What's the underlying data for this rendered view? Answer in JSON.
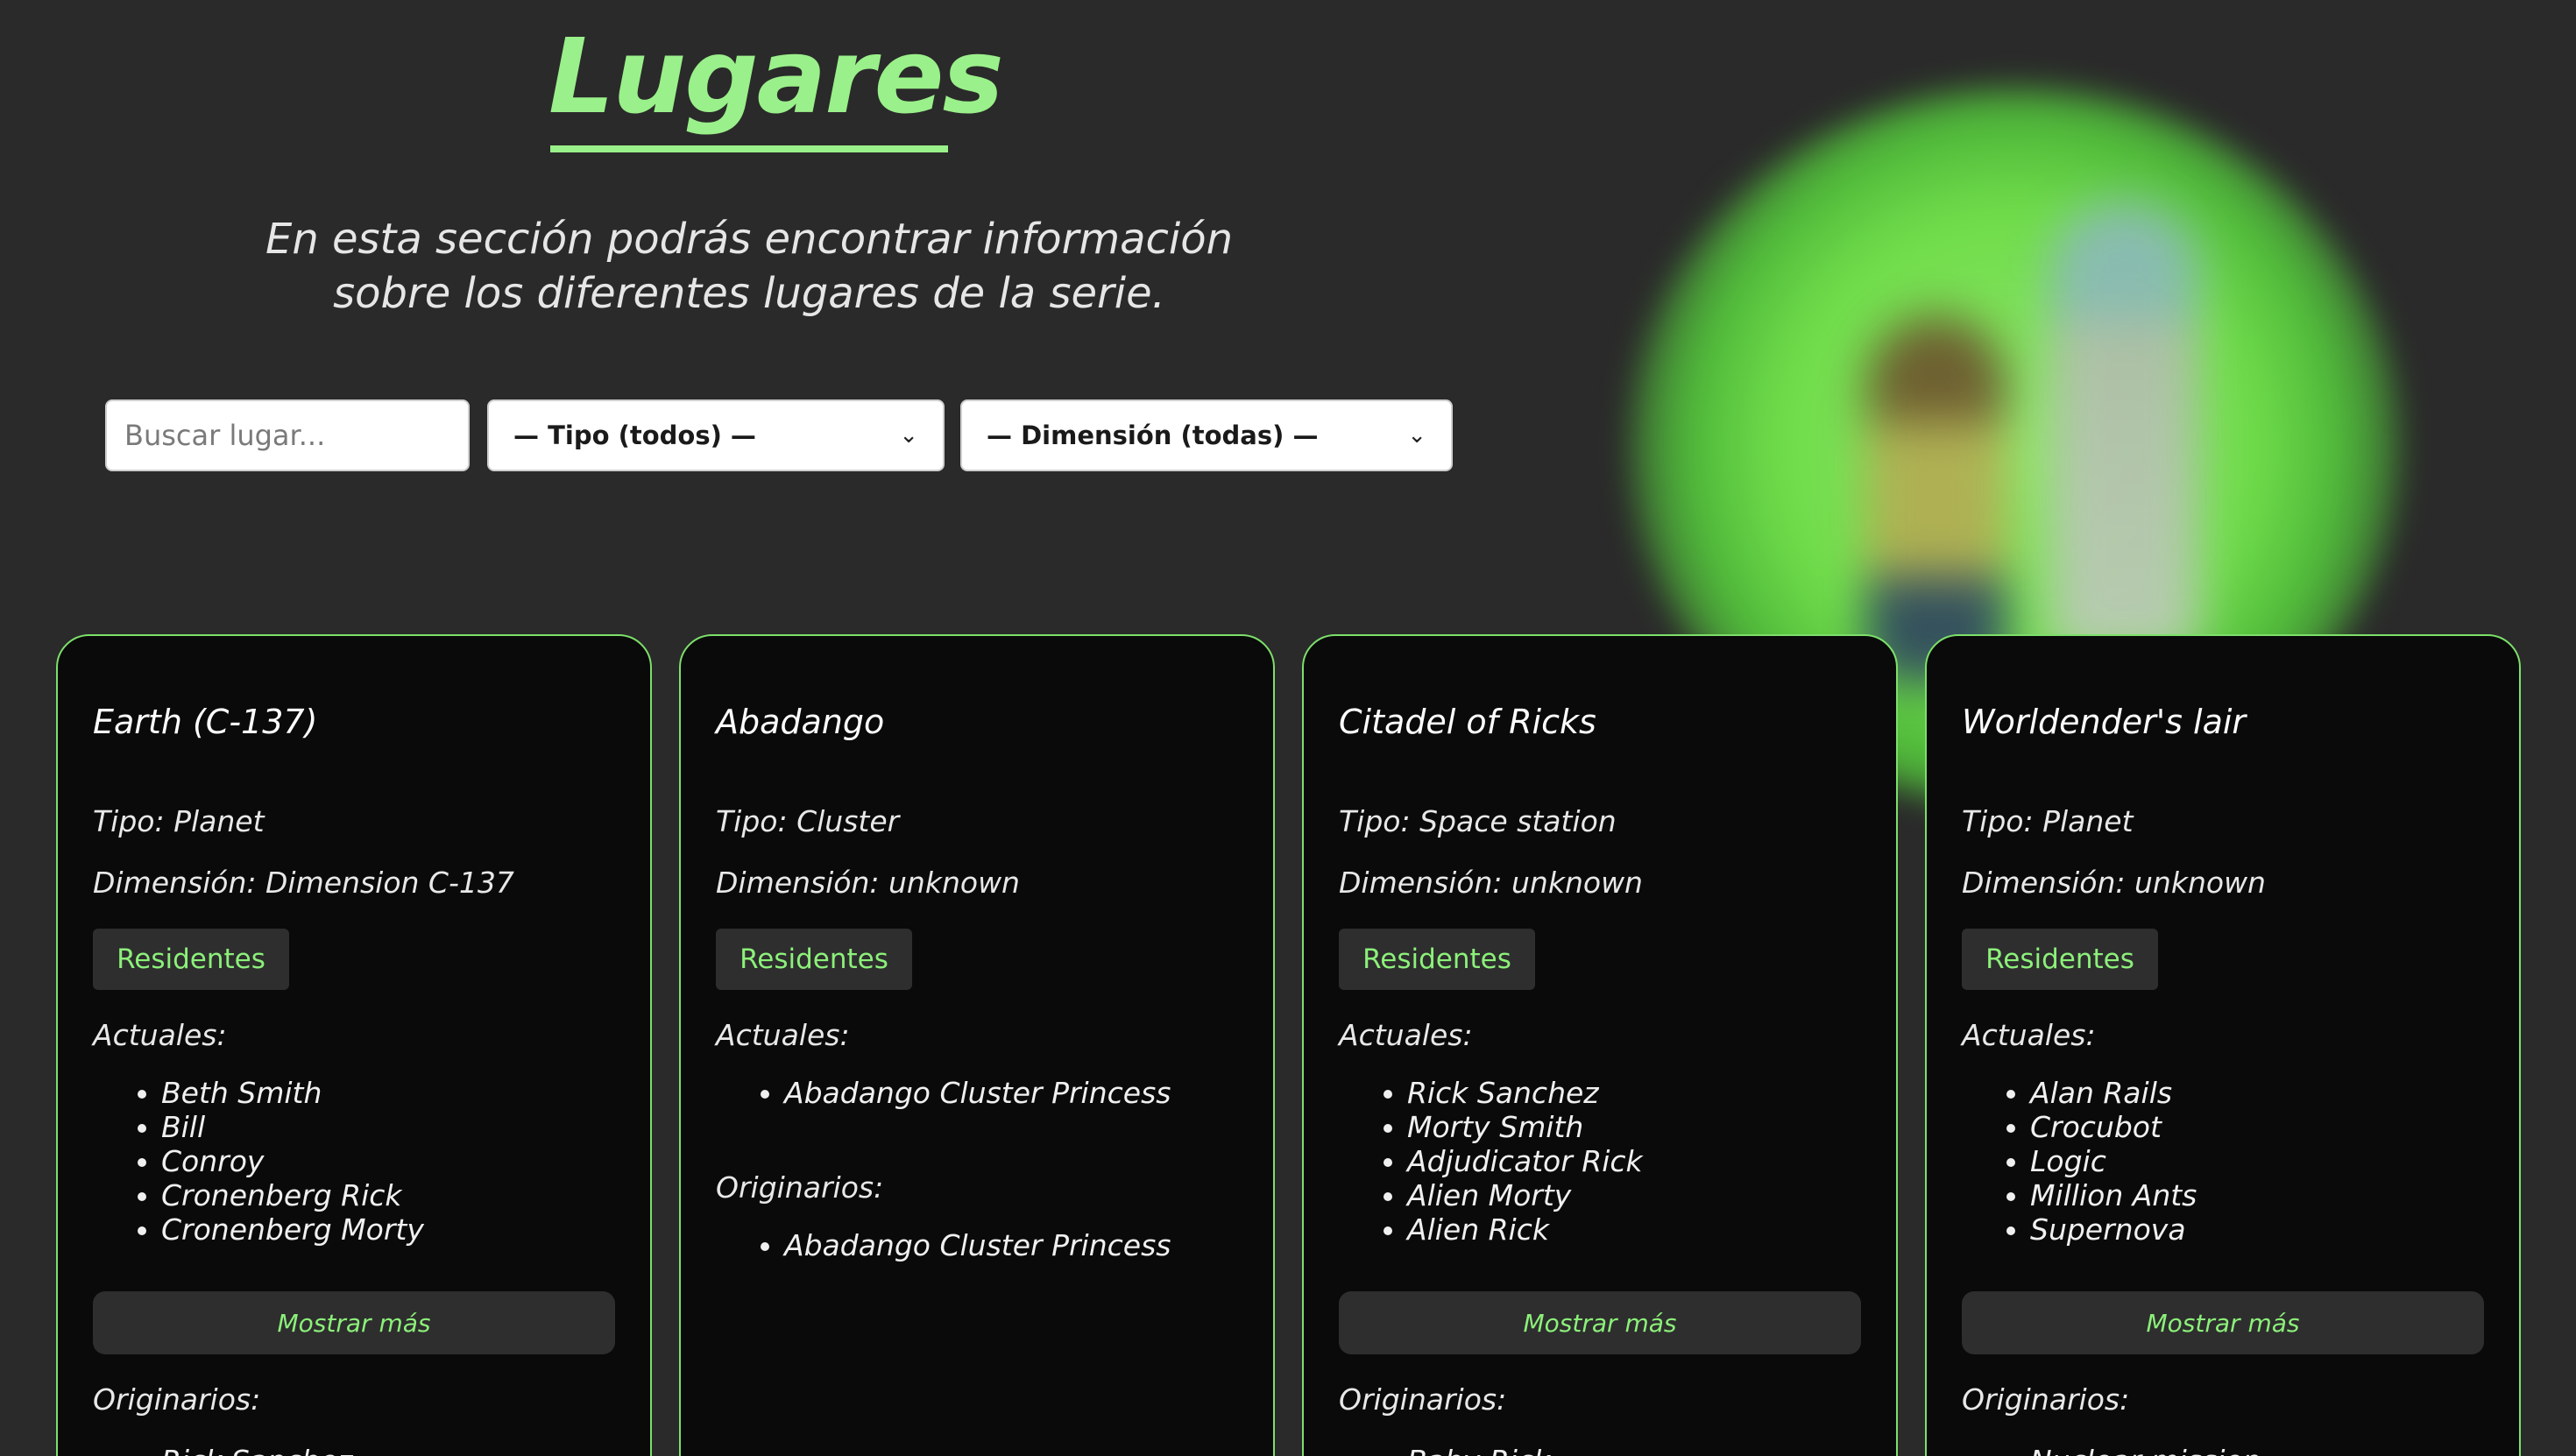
{
  "header": {
    "title": "Lugares",
    "subtitle": "En esta sección podrás encontrar información sobre los diferentes lugares de la serie."
  },
  "filters": {
    "search_placeholder": "Buscar lugar...",
    "type_selected": "— Tipo (todos) —",
    "dimension_selected": "— Dimensión (todas) —"
  },
  "colors": {
    "accent": "#9af08a",
    "background": "#2a2a2a",
    "card_background": "#0a0a0a",
    "card_border": "#7de06a"
  },
  "labels": {
    "residents_button": "Residentes",
    "current": "Actuales:",
    "originals": "Originarios:",
    "show_more": "Mostrar más"
  },
  "cards": [
    {
      "name": "Earth (C-137)",
      "type": "Tipo: Planet",
      "dimension": "Dimensión: Dimension C-137",
      "current": [
        "Beth Smith",
        "Bill",
        "Conroy",
        "Cronenberg Rick",
        "Cronenberg Morty"
      ],
      "originals": [
        "Rick Sanchez"
      ]
    },
    {
      "name": "Abadango",
      "type": "Tipo: Cluster",
      "dimension": "Dimensión: unknown",
      "current": [
        "Abadango Cluster Princess"
      ],
      "originals": [
        "Abadango Cluster Princess"
      ]
    },
    {
      "name": "Citadel of Ricks",
      "type": "Tipo: Space station",
      "dimension": "Dimensión: unknown",
      "current": [
        "Rick Sanchez",
        "Morty Smith",
        "Adjudicator Rick",
        "Alien Morty",
        "Alien Rick"
      ],
      "originals": [
        "Baby Rick"
      ]
    },
    {
      "name": "Worldender's lair",
      "type": "Tipo: Planet",
      "dimension": "Dimensión: unknown",
      "current": [
        "Alan Rails",
        "Crocubot",
        "Logic",
        "Million Ants",
        "Supernova"
      ],
      "originals": [
        "Nuclear mission"
      ]
    }
  ]
}
